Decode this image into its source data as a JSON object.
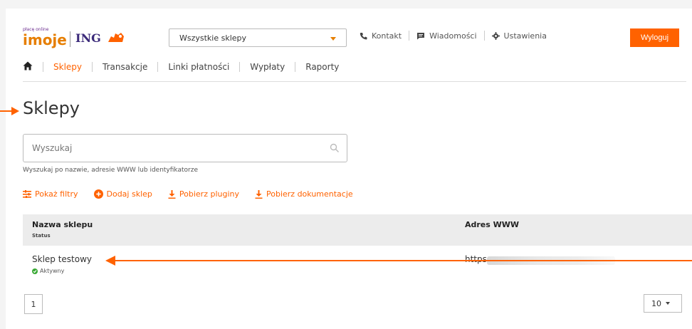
{
  "brand": {
    "small": "płacę online",
    "imoje": "imoje",
    "ing": "ING"
  },
  "store_select": {
    "value": "Wszystkie sklepy"
  },
  "toplinks": {
    "contact": "Kontakt",
    "messages": "Wiadomości",
    "settings": "Ustawienia"
  },
  "logout": "Wyloguj",
  "nav": {
    "items": [
      "Sklepy",
      "Transakcje",
      "Linki płatności",
      "Wypłaty",
      "Raporty"
    ],
    "active": "Sklepy"
  },
  "page_title": "Sklepy",
  "search": {
    "placeholder": "Wyszukaj",
    "hint": "Wyszukaj po nazwie, adresie WWW lub identyfikatorze"
  },
  "actions": {
    "filters": "Pokaż filtry",
    "add": "Dodaj sklep",
    "plugins": "Pobierz pluginy",
    "docs": "Pobierz dokumentacje"
  },
  "table": {
    "headers": {
      "name": "Nazwa sklepu",
      "status": "Status",
      "www": "Adres WWW"
    },
    "rows": [
      {
        "name": "Sklep testowy",
        "status": "Aktywny",
        "www": "https:"
      }
    ]
  },
  "pagination": {
    "page": "1",
    "per_page": "10"
  },
  "colors": {
    "accent": "#ff6200",
    "ing_purple": "#3b2a7a",
    "active_green": "#3aa935"
  }
}
